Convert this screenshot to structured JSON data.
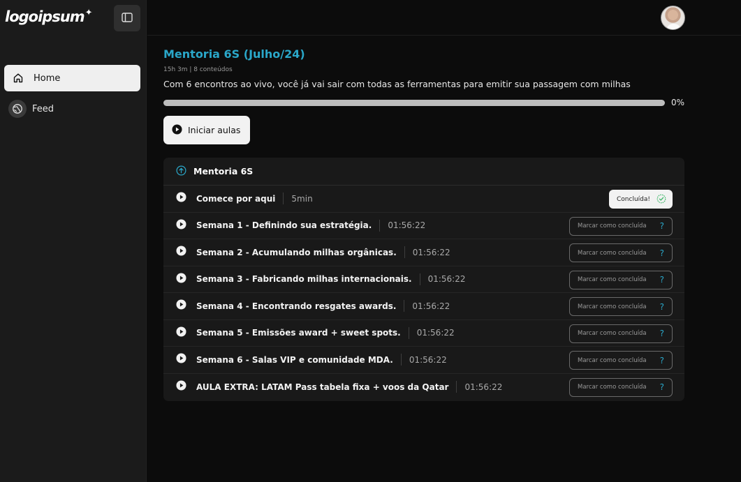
{
  "sidebar": {
    "logo": "logoipsum",
    "items": [
      {
        "label": "Home",
        "icon": "home-icon",
        "active": true
      },
      {
        "label": "Feed",
        "icon": "globe-icon",
        "active": false
      }
    ]
  },
  "course": {
    "title": "Mentoria 6S (Julho/24)",
    "meta": "15h 3m | 8 conteúdos",
    "description": "Com 6 encontros ao vivo, você  já vai sair com todas as ferramentas para emitir sua passagem com milhas",
    "progress": 0,
    "progress_label": "0%",
    "start_label": "Iniciar aulas"
  },
  "module": {
    "title": "Mentoria 6S",
    "lessons": [
      {
        "title": "Comece por aqui",
        "duration": "5min",
        "status_label": "Concluída!",
        "completed": true
      },
      {
        "title": "Semana 1 - Definindo sua estratégia.",
        "duration": "01:56:22",
        "status_label": "Marcar como concluída",
        "completed": false
      },
      {
        "title": "Semana 2 - Acumulando milhas orgânicas.",
        "duration": "01:56:22",
        "status_label": "Marcar como concluída",
        "completed": false
      },
      {
        "title": "Semana 3 - Fabricando milhas internacionais.",
        "duration": "01:56:22",
        "status_label": "Marcar como concluída",
        "completed": false
      },
      {
        "title": "Semana 4 - Encontrando resgates awards.",
        "duration": "01:56:22",
        "status_label": "Marcar como concluída",
        "completed": false
      },
      {
        "title": "Semana 5 - Emissões award + sweet spots.",
        "duration": "01:56:22",
        "status_label": "Marcar como concluída",
        "completed": false
      },
      {
        "title": "Semana 6 - Salas VIP e comunidade MDA.",
        "duration": "01:56:22",
        "status_label": "Marcar como concluída",
        "completed": false
      },
      {
        "title": "AULA EXTRA: LATAM Pass tabela fixa + voos da Qatar",
        "duration": "01:56:22",
        "status_label": "Marcar como concluída",
        "completed": false
      }
    ]
  },
  "colors": {
    "accent": "#2aa7c9",
    "success": "#3fb86a"
  }
}
